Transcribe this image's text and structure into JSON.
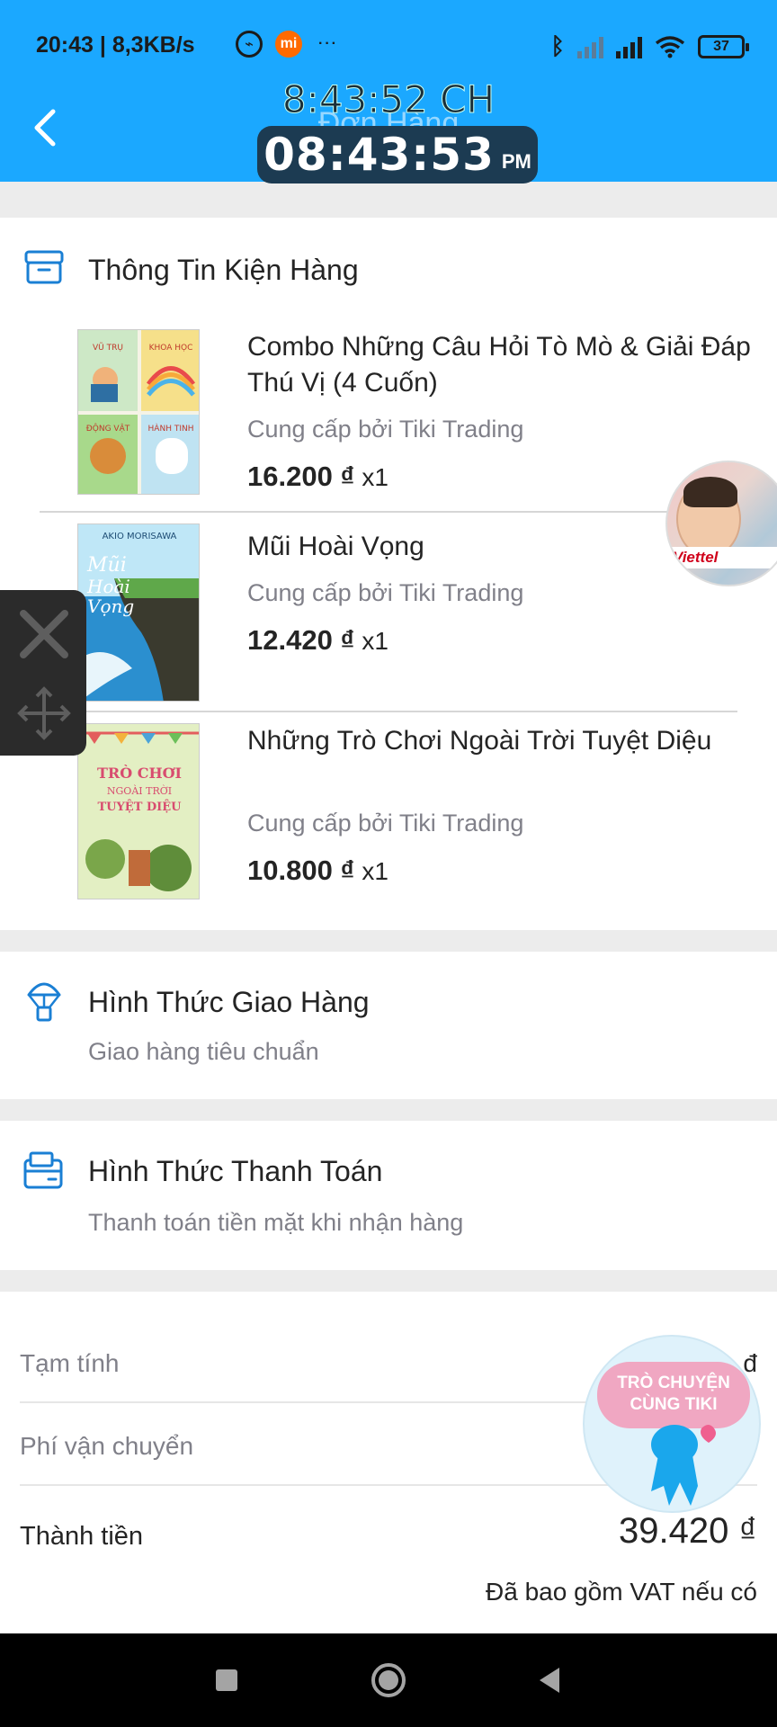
{
  "status_bar": {
    "time_speed": "20:43 | 8,3KB/s",
    "battery": "37"
  },
  "header": {
    "title": "Đơn Hàng",
    "overlay_clock_top": "8:43:52 CH",
    "overlay_clock_time": "08:43:53",
    "overlay_clock_ampm": "PM",
    "accent_color": "#1ba8ff"
  },
  "package": {
    "title": "Thông Tin Kiện Hàng",
    "items": [
      {
        "name": "Combo Những Câu Hỏi Tò Mò & Giải Đáp Thú Vị (4 Cuốn)",
        "seller": "Cung cấp bởi Tiki Trading",
        "price": "16.200 ₫",
        "qty": "x1"
      },
      {
        "name": "Mũi Hoài Vọng",
        "seller": "Cung cấp bởi Tiki Trading",
        "price": "12.420 ₫",
        "qty": "x1"
      },
      {
        "name": "Những Trò Chơi Ngoài Trời Tuyệt Diệu",
        "seller": "Cung cấp bởi Tiki Trading",
        "price": "10.800 ₫",
        "qty": "x1"
      }
    ]
  },
  "shipping": {
    "title": "Hình Thức Giao Hàng",
    "value": "Giao hàng tiêu chuẩn"
  },
  "payment": {
    "title": "Hình Thức Thanh Toán",
    "value": "Thanh toán tiền mặt khi nhận hàng"
  },
  "summary": {
    "subtotal_label": "Tạm tính",
    "subtotal_value_visible": "đ",
    "shipping_label": "Phí vận chuyển",
    "total_label": "Thành tiền",
    "total_value": "39.420 ₫",
    "vat_note": "Đã bao gồm VAT nếu có"
  },
  "overlays": {
    "avatar_brand": "Viettel",
    "chat_bubble_text": "TRÒ CHUYỆN CÙNG TIKI"
  }
}
